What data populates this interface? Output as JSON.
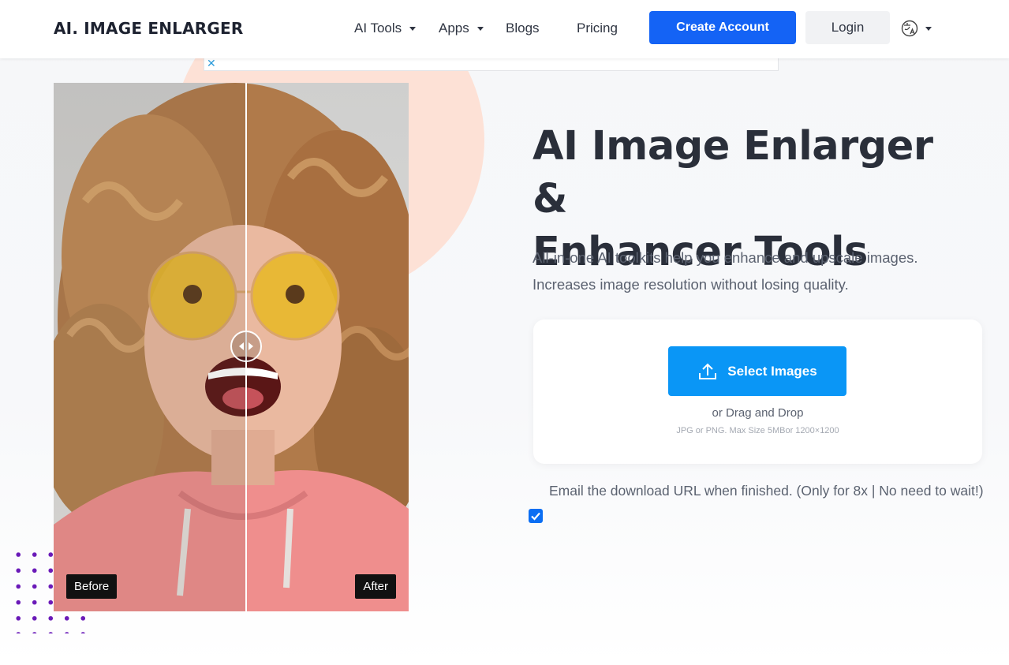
{
  "header": {
    "logo": "AI. IMAGE ENLARGER",
    "nav": [
      {
        "label": "AI Tools",
        "dropdown": true
      },
      {
        "label": "Apps",
        "dropdown": true
      },
      {
        "label": "Blogs",
        "dropdown": false
      },
      {
        "label": "Pricing",
        "dropdown": false
      }
    ],
    "create_account": "Create Account",
    "login": "Login",
    "language_icon": "language-globe-icon"
  },
  "ad": {
    "close_icon": "close-x-icon"
  },
  "compare": {
    "before_label": "Before",
    "after_label": "After",
    "handle_icon": "left-right-arrows-icon"
  },
  "hero": {
    "title_line1": "AI Image Enlarger &",
    "title_line2": "Enhancer Tools",
    "subtitle_line1": "All-in-one AI toolkits help you enhance and upscale images.",
    "subtitle_line2": "Increases image resolution without losing quality."
  },
  "upload": {
    "button_label": "Select Images",
    "button_icon": "upload-icon",
    "drag_text": "or Drag and Drop",
    "limits": "JPG or PNG. Max Size 5MBor 1200×1200"
  },
  "email_option": {
    "label": "Email the download URL when finished. (Only for 8x | No need to wait!)",
    "checked": true
  },
  "colors": {
    "primary_blue": "#1463f5",
    "upload_blue": "#0a96f6",
    "peach": "#fde1d6",
    "dots_purple": "#6a1ab8"
  }
}
